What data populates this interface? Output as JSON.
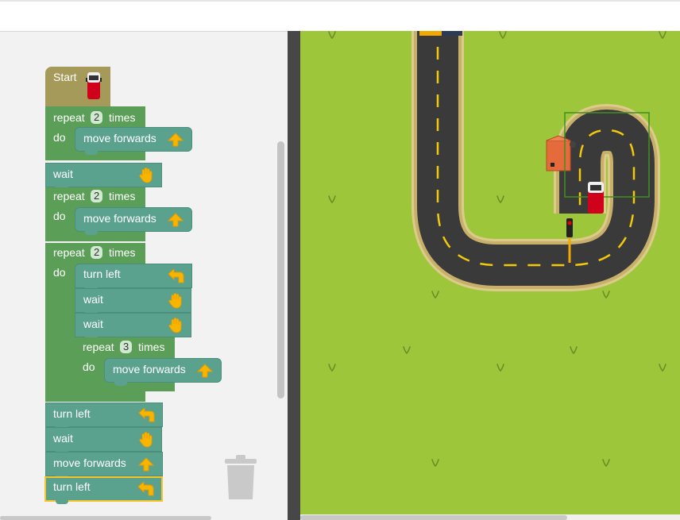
{
  "blocks": {
    "start": {
      "label": "Start",
      "icon": "van-icon"
    },
    "repeat1": {
      "repeat_label": "repeat",
      "count": "2",
      "times_label": "times",
      "do_label": "do",
      "child": "move forwards"
    },
    "wait1": {
      "label": "wait"
    },
    "repeat2": {
      "repeat_label": "repeat",
      "count": "2",
      "times_label": "times",
      "do_label": "do",
      "child": "move forwards"
    },
    "repeat3": {
      "repeat_label": "repeat",
      "count": "2",
      "times_label": "times",
      "do_label": "do",
      "children": [
        "turn left",
        "wait",
        "wait"
      ],
      "inner": {
        "repeat_label": "repeat",
        "count": "3",
        "times_label": "times",
        "do_label": "do",
        "child": "move forwards"
      }
    },
    "tail": [
      "turn left",
      "wait",
      "move forwards",
      "turn left"
    ]
  },
  "icons": {
    "move": "arrow-up-icon",
    "turn_left": "turn-left-arrow-icon",
    "wait": "hand-icon",
    "trash": "trash-icon"
  },
  "colors": {
    "start_block": "#a69a5a",
    "control_block": "#5b9e57",
    "action_block": "#5aa28e",
    "selected_outline": "#f7c52a",
    "grass": "#9ec63a",
    "road": "#3a3a3a",
    "lane_marking": "#f2c80c"
  }
}
